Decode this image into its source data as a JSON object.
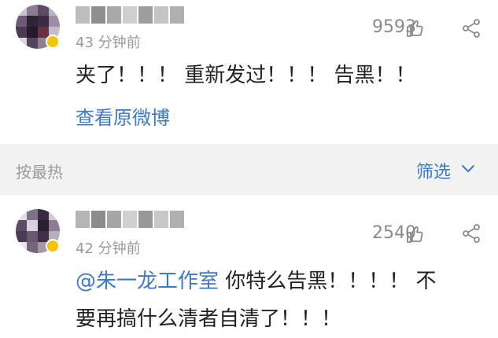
{
  "comments": [
    {
      "time": "43 分钟前",
      "likes": "9593",
      "text": "夹了！！！ 重新发过！！！ 告黑！！",
      "link": "查看原微博"
    },
    {
      "time": "42 分钟前",
      "likes": "2540",
      "mention": "@朱一龙工作室",
      "text_line1": " 你特么告黑！！！！ 不",
      "text_line2": "要再搞什么清者自清了！！！"
    }
  ],
  "sortbar": {
    "label": "按最热",
    "filter_label": "筛选"
  },
  "icons": [
    "thumbs-up-icon",
    "share-icon",
    "chevron-down-icon"
  ],
  "colors": {
    "link_blue": "#3d78c9",
    "muted_gray": "#9a9a9a",
    "sort_bg": "#f2f2f2"
  }
}
